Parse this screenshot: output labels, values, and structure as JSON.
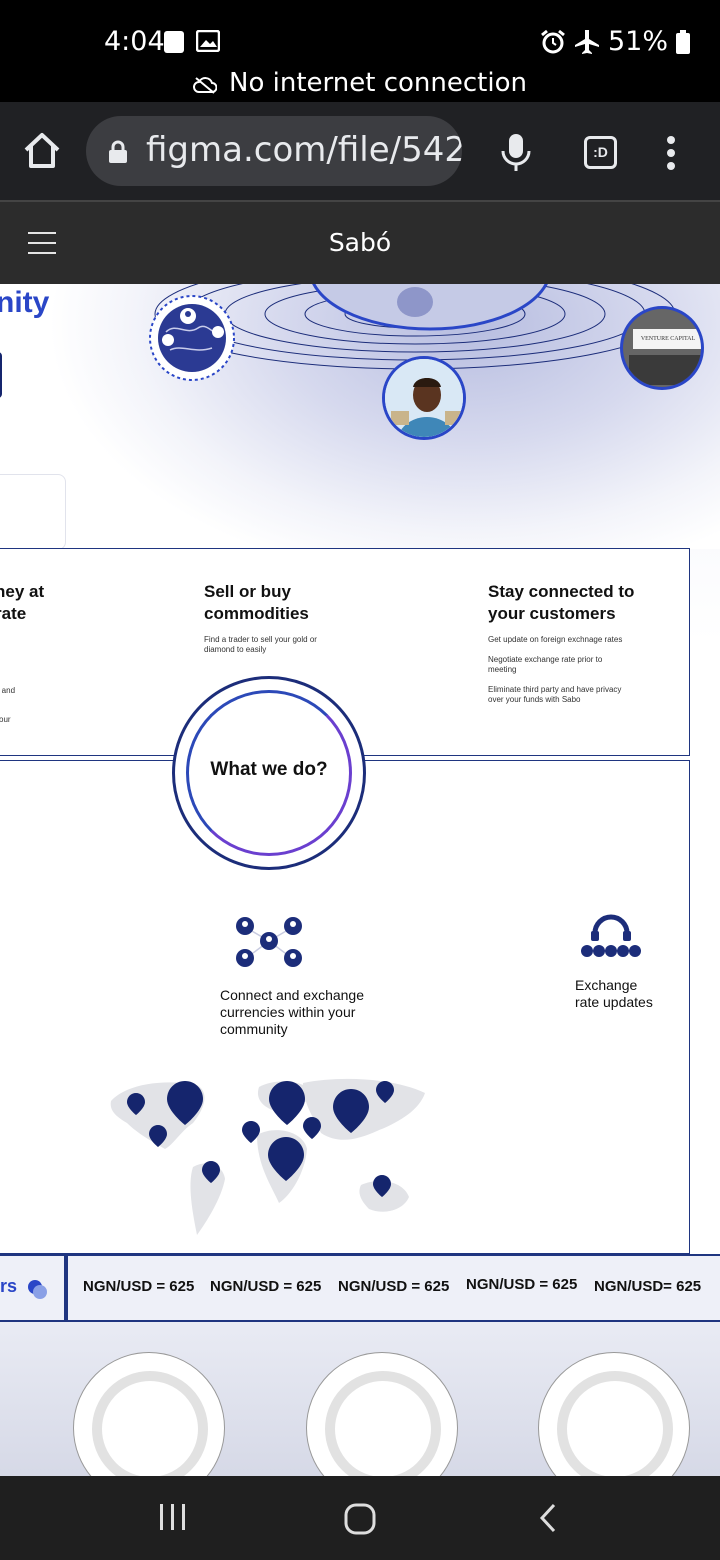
{
  "status_bar": {
    "time": "4:04",
    "battery": "51%",
    "offline_message": "No internet connection"
  },
  "browser": {
    "url": "figma.com/file/542",
    "tabs_label": ":D"
  },
  "figma": {
    "file_title": "Sabó"
  },
  "hero": {
    "partial_heading": "nity",
    "venture_label": "VENTURE CAPITAL"
  },
  "services": {
    "col1": {
      "title_line1": "ney at",
      "title_line2": "rate",
      "small1": "e and",
      "small2": "your"
    },
    "col2": {
      "title_line1": "Sell or buy",
      "title_line2": "commodities",
      "desc_line1": "Find a trader to sell your gold or",
      "desc_line2": "diamond  to easily"
    },
    "col3": {
      "title_line1": "Stay connected to",
      "title_line2": "your customers",
      "bullet1": "Get update on foreign exchnage rates",
      "bullet2_line1": "Negotiate exchange rate prior to",
      "bullet2_line2": "meeting",
      "bullet3_line1": "Eliminate third party and have privacy",
      "bullet3_line2": "over your funds with Sabo"
    }
  },
  "what_we_do": {
    "title": "What we do?",
    "feature1_line1": "Connect and exchange",
    "feature1_line2": "currencies within your",
    "feature1_line3": "community",
    "feature2_line1": "Exchange",
    "feature2_line2": "rate updates"
  },
  "ticker": {
    "left_label": "rs",
    "items": [
      "NGN/USD = 625",
      "NGN/USD = 625",
      "NGN/USD = 625",
      "NGN/USD = 625",
      "NGN/USD= 625"
    ]
  },
  "colors": {
    "brand_blue": "#15256d",
    "accent_blue": "#2a46c7",
    "accent_purple": "#6a3fcf"
  }
}
